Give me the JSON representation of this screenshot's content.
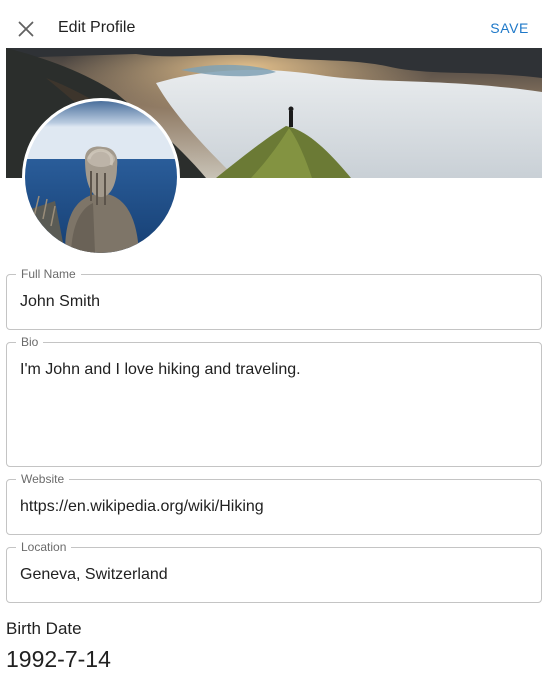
{
  "header": {
    "close_icon": "close-icon",
    "title": "Edit Profile",
    "save_label": "SAVE"
  },
  "images": {
    "cover": "mountain ridge above clouds with lake at sunset",
    "avatar": "person in knitted hooded sweater facing the sea"
  },
  "form": {
    "full_name": {
      "label": "Full Name",
      "value": "John Smith"
    },
    "bio": {
      "label": "Bio",
      "value": "I'm John and I love hiking and traveling."
    },
    "website": {
      "label": "Website",
      "value": "https://en.wikipedia.org/wiki/Hiking"
    },
    "location": {
      "label": "Location",
      "value": "Geneva, Switzerland"
    }
  },
  "birth_date": {
    "label": "Birth Date",
    "value": "1992-7-14"
  },
  "colors": {
    "accent": "#1e78c8",
    "border": "#c4c4c4",
    "label": "#6b6b6b",
    "text": "#212121"
  }
}
